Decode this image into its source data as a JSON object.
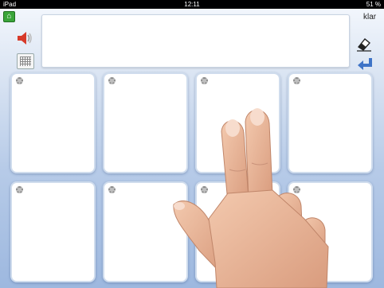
{
  "statusbar": {
    "device": "iPad",
    "time": "12:11",
    "battery": "51 %"
  },
  "toolbar": {
    "done_label": "klar"
  },
  "icons": {
    "home": "home-icon",
    "speaker": "speaker-icon",
    "keyboard": "keyboard-icon",
    "clear": "eraser-icon",
    "enter": "enter-arrow-icon",
    "tile_settings": "gear-icon"
  },
  "message": {
    "value": ""
  },
  "tiles": [
    {
      "label": ""
    },
    {
      "label": ""
    },
    {
      "label": ""
    },
    {
      "label": ""
    },
    {
      "label": ""
    },
    {
      "label": ""
    },
    {
      "label": ""
    },
    {
      "label": ""
    }
  ],
  "colors": {
    "home_button": "#3aa53a",
    "speaker": "#d73a2a",
    "enter_arrow": "#3f74c7",
    "tile_border": "#cfdced"
  }
}
